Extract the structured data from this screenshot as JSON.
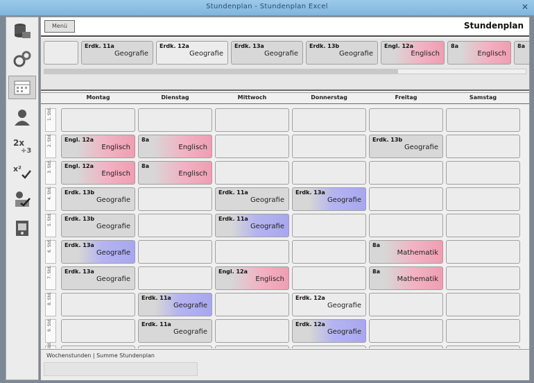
{
  "window": {
    "title": "Stundenplan - Stundenplan Excel",
    "close_label": "✕"
  },
  "sidebar": {
    "items": [
      {
        "name": "nav-database",
        "icon": "database-icon"
      },
      {
        "name": "nav-settings",
        "icon": "gears-icon"
      },
      {
        "name": "nav-calendar",
        "icon": "calendar-icon",
        "active": true
      },
      {
        "name": "nav-person",
        "icon": "person-icon"
      },
      {
        "name": "nav-math",
        "icon": "math-icon"
      },
      {
        "name": "nav-math-check",
        "icon": "math-check-icon"
      },
      {
        "name": "nav-edit-check",
        "icon": "edit-check-icon"
      },
      {
        "name": "nav-print",
        "icon": "print-icon"
      }
    ]
  },
  "toolbar": {
    "menu_label": "Menü",
    "page_title": "Stundenplan"
  },
  "strip": {
    "cards": [
      {
        "cls": "",
        "subj": "",
        "color": "empty"
      },
      {
        "cls": "Erdk. 11a",
        "subj": "Geografie",
        "color": "grey"
      },
      {
        "cls": "Erdk. 12a",
        "subj": "Geografie",
        "color": "empty"
      },
      {
        "cls": "Erdk. 13a",
        "subj": "Geografie",
        "color": "grey"
      },
      {
        "cls": "Erdk. 13b",
        "subj": "Geografie",
        "color": "grey"
      },
      {
        "cls": "Engl. 12a",
        "subj": "Englisch",
        "color": "pink"
      },
      {
        "cls": "8a",
        "subj": "Englisch",
        "color": "pink"
      },
      {
        "cls": "8a",
        "subj": "",
        "color": "grey"
      }
    ]
  },
  "days": [
    "Montag",
    "Dienstag",
    "Mittwoch",
    "Donnerstag",
    "Freitag",
    "Samstag"
  ],
  "periods": [
    "1. Std.",
    "2. Std.",
    "3. Std.",
    "4. Std.",
    "5. Std.",
    "6. Std.",
    "7. Std.",
    "8. Std.",
    "9. Std.",
    "10. Std."
  ],
  "grid": [
    [
      null,
      null,
      null,
      null,
      null,
      null
    ],
    [
      {
        "cls": "Engl. 12a",
        "subj": "Englisch",
        "color": "pink"
      },
      {
        "cls": "8a",
        "subj": "Englisch",
        "color": "pink"
      },
      null,
      null,
      {
        "cls": "Erdk. 13b",
        "subj": "Geografie",
        "color": "grey"
      },
      null
    ],
    [
      {
        "cls": "Engl. 12a",
        "subj": "Englisch",
        "color": "pink"
      },
      {
        "cls": "8a",
        "subj": "Englisch",
        "color": "pink"
      },
      null,
      null,
      null,
      null
    ],
    [
      {
        "cls": "Erdk. 13b",
        "subj": "Geografie",
        "color": "grey"
      },
      null,
      {
        "cls": "Erdk. 11a",
        "subj": "Geografie",
        "color": "grey"
      },
      {
        "cls": "Erdk. 13a",
        "subj": "Geografie",
        "color": "blue"
      },
      null,
      null
    ],
    [
      {
        "cls": "Erdk. 13b",
        "subj": "Geografie",
        "color": "grey"
      },
      null,
      {
        "cls": "Erdk. 11a",
        "subj": "Geografie",
        "color": "blue"
      },
      null,
      null,
      null
    ],
    [
      {
        "cls": "Erdk. 13a",
        "subj": "Geografie",
        "color": "blue"
      },
      null,
      null,
      null,
      {
        "cls": "8a",
        "subj": "Mathematik",
        "color": "pink"
      },
      null
    ],
    [
      {
        "cls": "Erdk. 13a",
        "subj": "Geografie",
        "color": "grey"
      },
      null,
      {
        "cls": "Engl. 12a",
        "subj": "Englisch",
        "color": "pink"
      },
      null,
      {
        "cls": "8a",
        "subj": "Mathematik",
        "color": "pink"
      },
      null
    ],
    [
      null,
      {
        "cls": "Erdk. 11a",
        "subj": "Geografie",
        "color": "blue"
      },
      null,
      {
        "cls": "Erdk. 12a",
        "subj": "Geografie",
        "color": "empty"
      },
      null,
      null
    ],
    [
      null,
      {
        "cls": "Erdk. 11a",
        "subj": "Geografie",
        "color": "grey"
      },
      null,
      {
        "cls": "Erdk. 12a",
        "subj": "Geografie",
        "color": "blue"
      },
      null,
      null
    ],
    [
      null,
      null,
      null,
      null,
      null,
      null
    ]
  ],
  "footer": {
    "note": "Wochenstunden | Summe Stundenplan"
  }
}
